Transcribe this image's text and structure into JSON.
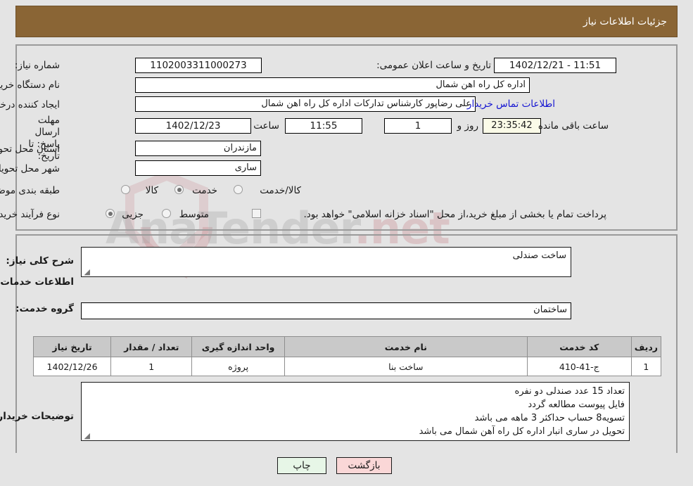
{
  "header": {
    "title": "جزئیات اطلاعات نیاز"
  },
  "watermark": {
    "brand": "AnaTender",
    "suffix": ".net"
  },
  "need_info": {
    "need_number_label": "شماره نیاز:",
    "need_number_value": "1102003311000273",
    "announce_label": "تاریخ و ساعت اعلان عمومی:",
    "announce_value": "1402/12/21 - 11:51",
    "buyer_org_label": "نام دستگاه خریدار:",
    "buyer_org_value": "اداره کل راه اهن شمال",
    "creator_label": "ایجاد کننده درخواست:",
    "creator_value": "علی رضاپور کارشناس تدارکات اداره کل راه اهن شمال",
    "contact_link": "اطلاعات تماس خریدار",
    "deadline_label": "مهلت ارسال پاسخ: تا تاریخ:",
    "deadline_date": "1402/12/23",
    "hour_label": "ساعت",
    "deadline_time": "11:55",
    "remaining_days": "1",
    "days_and_label": "روز و",
    "remaining_time": "23:35:42",
    "remaining_suffix": "ساعت باقی مانده",
    "province_label": "استان محل تحویل:",
    "province_value": "مازندران",
    "city_label": "شهر محل تحویل:",
    "city_value": "ساری",
    "category_label": "طبقه بندی موضوعی:",
    "category_options": [
      {
        "label": "کالا",
        "selected": false
      },
      {
        "label": "خدمت",
        "selected": true
      },
      {
        "label": "کالا/خدمت",
        "selected": false
      }
    ],
    "process_label": "نوع فرآیند خرید :",
    "process_options": [
      {
        "label": "جزیی",
        "selected": true
      },
      {
        "label": "متوسط",
        "selected": false
      }
    ],
    "treasury_checkbox_checked": false,
    "treasury_text": "پرداخت تمام یا بخشی از مبلغ خرید،از محل \"اسناد خزانه اسلامی\" خواهد بود."
  },
  "description": {
    "general_label": "شرح کلی نیاز:",
    "general_value": "ساخت صندلی",
    "section_title": "اطلاعات خدمات مورد نیاز",
    "service_group_label": "گروه خدمت:",
    "service_group_value": "ساختمان"
  },
  "table": {
    "headers": [
      "ردیف",
      "کد خدمت",
      "نام خدمت",
      "واحد اندازه گیری",
      "تعداد / مقدار",
      "تاریخ نیاز"
    ],
    "rows": [
      {
        "row": "1",
        "code": "ج-41-410",
        "name": "ساخت بنا",
        "unit": "پروژه",
        "qty": "1",
        "date": "1402/12/26"
      }
    ]
  },
  "buyer_notes": {
    "label": "توضیحات خریدار:",
    "lines": [
      "تعداد 15 عدد صندلی دو نفره",
      "فایل پیوست مطالعه گردد",
      "تسویه8 حساب حداکثر 3 ماهه می باشد",
      "تحویل در ساری انبار اداره کل راه آهن شمال می باشد"
    ]
  },
  "footer": {
    "print_label": "چاپ",
    "back_label": "بازگشت"
  },
  "colors": {
    "title_bar": "#8a6535",
    "link": "#1414d2",
    "timer_bg": "#fbfbe8",
    "print_bg": "#e7f6e7",
    "back_bg": "#fad7d7"
  }
}
